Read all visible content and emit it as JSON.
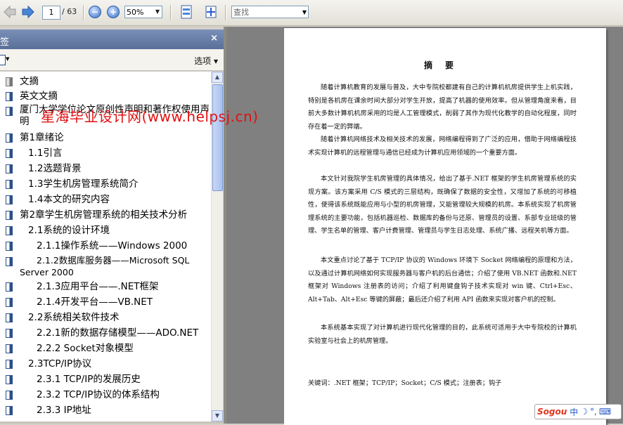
{
  "toolbar": {
    "current_page": "1",
    "total_pages": "/ 63",
    "zoom": "50%",
    "find_placeholder": "查找"
  },
  "panel": {
    "title": "签",
    "close": "×",
    "options": "选项"
  },
  "bookmarks": [
    {
      "label": "文摘",
      "grey": true
    },
    {
      "label": "英文文摘"
    },
    {
      "label": "厦门大学学位论文原创性声明和著作权使用声明"
    },
    {
      "label": "第1章绪论"
    },
    {
      "label": "1.1引言"
    },
    {
      "label": "1.2选题背景"
    },
    {
      "label": "1.3学生机房管理系统简介"
    },
    {
      "label": "1.4本文的研究内容"
    },
    {
      "label": "第2章学生机房管理系统的相关技术分析"
    },
    {
      "label": "2.1系统的设计环境"
    },
    {
      "label": "2.1.1操作系统——Windows 2000"
    },
    {
      "label": "2.1.2数据库服务器——Microsoft SQL Server 2000"
    },
    {
      "label": "2.1.3应用平台——.NET框架"
    },
    {
      "label": "2.1.4开发平台——VB.NET"
    },
    {
      "label": "2.2系统相关软件技术"
    },
    {
      "label": "2.2.1新的数据存储模型——ADO.NET"
    },
    {
      "label": "2.2.2 Socket对象模型"
    },
    {
      "label": "2.3TCP/IP协议"
    },
    {
      "label": "2.3.1 TCP/IP的发展历史"
    },
    {
      "label": "2.3.2 TCP/IP协议的体系结构"
    },
    {
      "label": "2.3.3 IP地址"
    }
  ],
  "watermark": "星海毕业设计网(www.helpsj.cn)",
  "document": {
    "title": "摘要",
    "paragraphs": [
      "随着计算机教育的发展与普及，大中专院校都建有自己的计算机机房提供学生上机实践，特别是各机房在课余时间大部分对学生开放，提高了机器的使用效率。但从管理角度来看，目前大多数计算机机房采用的均是人工管理模式，削弱了其作为现代化教学的自动化程度，同时存在着一定的弊端。",
      "随着计算机网络技术及相关技术的发展，网络编程得到了广泛的应用，借助于网络编程技术实现计算机的远程管理与通信已经成为计算机应用领域的一个重要方面。",
      "本文针对我院学生机房管理的具体情况，给出了基于.NET 框架的学生机房管理系统的实现方案。该方案采用 C/S 模式的三层结构，既确保了数据的安全性，又增加了系统的可移植性，使得该系统既能应用与小型的机房管理，又能管理较大规模的机房。本系统实现了机房管理系统的主要功能，包括机器巡检、数据库的备份与还原、管理员的设置、系部专业班级的管理、学生名单的管理、客户计费管理、管理员与学生日志处理、系统广播、远程关机等方面。",
      "本文重点讨论了基于 TCP/IP 协议的 Windows 环境下 Socket 网络编程的原理和方法，以及通过计算机网络如何实现服务器与客户机的后台通信；介绍了使用 VB.NET 函数和.NET 框架对 Windows 注册表的访问；介绍了利用键盘钩子技术实现对 win 键、Ctrl+Esc、Alt+Tab、Alt+Esc 等键的屏蔽；最后还介绍了利用 API 函数来实现对客户机的控制。",
      "本系统基本实现了对计算机进行现代化管理的目的，此系统可适用于大中专院校的计算机实验室与社会上的机房管理。"
    ],
    "keywords": "关键词：.NET 框架；TCP/IP；Socket；C/S 模式；注册表；钩子"
  },
  "sogou": {
    "logo": "Sogou",
    "mode": "中"
  },
  "colors": {
    "watermark": "#e21010",
    "panel_header": "#5a6f98",
    "bookmark_icon": "#2a4f8a"
  }
}
